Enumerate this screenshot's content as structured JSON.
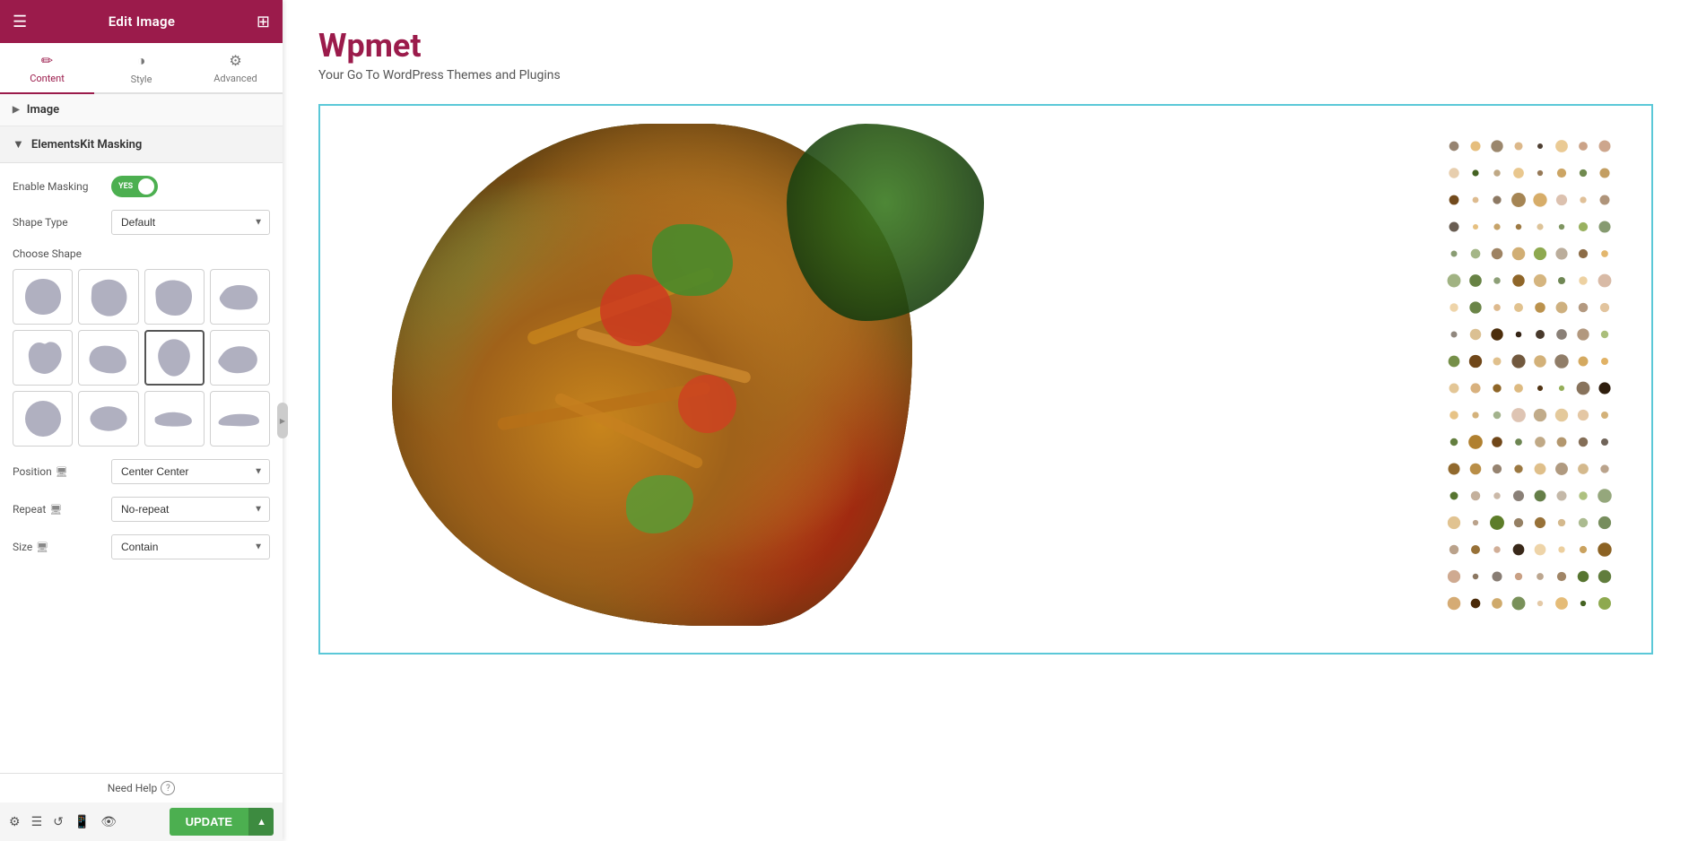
{
  "header": {
    "title": "Edit Image",
    "hamburger": "☰",
    "grid": "⊞"
  },
  "tabs": [
    {
      "id": "content",
      "label": "Content",
      "icon": "✏️",
      "active": true
    },
    {
      "id": "style",
      "label": "Style",
      "icon": "◑",
      "active": false
    },
    {
      "id": "advanced",
      "label": "Advanced",
      "icon": "⚙️",
      "active": false
    }
  ],
  "sections": {
    "image": {
      "label": "Image",
      "collapsed": true
    },
    "masking": {
      "label": "ElementsKit Masking",
      "collapsed": false,
      "enable_masking_label": "Enable Masking",
      "toggle_value": "YES",
      "shape_type_label": "Shape Type",
      "shape_type_value": "Default",
      "choose_shape_label": "Choose Shape",
      "shapes": [
        {
          "id": 1,
          "selected": false
        },
        {
          "id": 2,
          "selected": false
        },
        {
          "id": 3,
          "selected": false
        },
        {
          "id": 4,
          "selected": false
        },
        {
          "id": 5,
          "selected": false
        },
        {
          "id": 6,
          "selected": false
        },
        {
          "id": 7,
          "selected": true
        },
        {
          "id": 8,
          "selected": false
        },
        {
          "id": 9,
          "selected": false
        },
        {
          "id": 10,
          "selected": false
        },
        {
          "id": 11,
          "selected": false
        },
        {
          "id": 12,
          "selected": false
        }
      ],
      "position_label": "Position",
      "position_value": "Center Center",
      "repeat_label": "Repeat",
      "repeat_value": "No-repeat",
      "size_label": "Size",
      "size_value": "Contain"
    }
  },
  "footer": {
    "need_help": "Need Help",
    "update_label": "UPDATE"
  },
  "main": {
    "site_title": "Wpmet",
    "site_subtitle": "Your Go To WordPress Themes and Plugins"
  },
  "colors": {
    "accent": "#9b1b4b",
    "green": "#4caf50",
    "cyan_border": "#5bc8d8"
  }
}
